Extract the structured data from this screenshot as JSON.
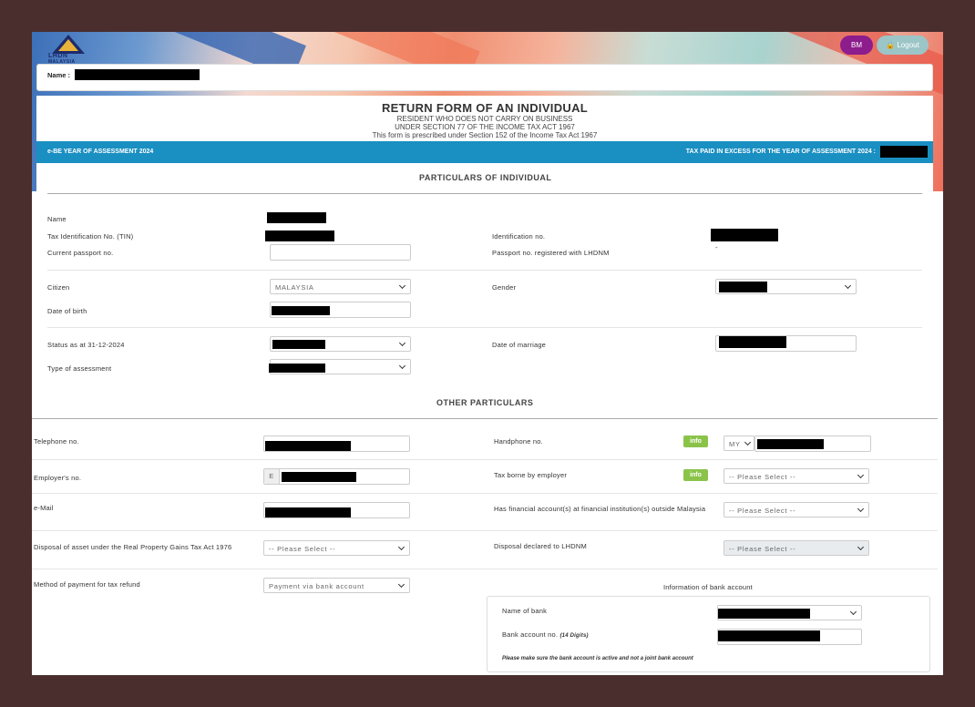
{
  "header": {
    "logo_text": "LHDN",
    "logo_sub": "MALAYSIA",
    "lang_button": "BM",
    "logout_button": "Logout",
    "name_label": "Name  :"
  },
  "form_title": {
    "title": "RETURN FORM OF AN INDIVIDUAL",
    "line1": "RESIDENT WHO DOES NOT CARRY ON BUSINESS",
    "line2": "UNDER SECTION 77 OF THE INCOME TAX ACT 1967",
    "line3": "This form is prescribed under Section 152 of the Income Tax Act 1967"
  },
  "year_bar": {
    "left": "e-BE YEAR OF ASSESSMENT 2024",
    "right": "TAX PAID IN EXCESS FOR THE YEAR OF ASSESSMENT 2024 :"
  },
  "particulars": {
    "heading": "PARTICULARS OF INDIVIDUAL",
    "name": "Name",
    "tin": "Tax Identification No. (TIN)",
    "id_no": "Identification no.",
    "passport": "Current passport no.",
    "passport_reg": "Passport no. registered with LHDNM",
    "passport_reg_value": "-",
    "citizen": "Citizen",
    "citizen_value": "MALAYSIA",
    "gender": "Gender",
    "dob": "Date of birth",
    "status": "Status as at 31-12-2024",
    "marriage": "Date of marriage",
    "assessment_type": "Type of assessment"
  },
  "other": {
    "heading": "OTHER PARTICULARS",
    "telephone": "Telephone no.",
    "handphone": "Handphone no.",
    "info": "info",
    "country_code": "MY",
    "employer_no": "Employer's no.",
    "employer_prefix": "E",
    "tax_borne": "Tax borne by employer",
    "please_select": "-- Please Select --",
    "email": "e-Mail",
    "foreign_account": "Has financial account(s) at financial institution(s) outside Malaysia",
    "rpgt": "Disposal of asset under the Real Property Gains Tax Act 1976",
    "disposal_declared": "Disposal declared to LHDNM",
    "refund_method": "Method of payment for tax refund",
    "refund_value": "Payment via bank account",
    "bank_info": "Information of bank account",
    "bank_name": "Name of bank",
    "bank_acc": "Bank account no.",
    "bank_acc_hint": "(14 Digits)",
    "bank_note": "Please make sure the bank account is active and not a joint bank account"
  }
}
